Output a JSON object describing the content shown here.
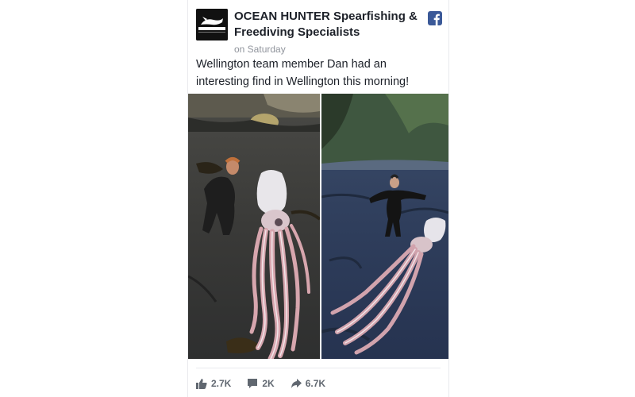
{
  "post": {
    "page_name": "OCEAN HUNTER Spearfishing & Freediving Specialists",
    "avatar_text": "OCEAN HUNTER",
    "timestamp": "on Saturday",
    "message": "Wellington team member Dan had an interesting find in Wellington this morning!",
    "platform_icon": "facebook-icon",
    "photos": [
      {
        "name": "photo-man-with-giant-squid-on-beach"
      },
      {
        "name": "photo-man-behind-giant-squid-on-beach"
      }
    ]
  },
  "reactions": {
    "likes": "2.7K",
    "comments": "2K",
    "shares": "6.7K"
  },
  "colors": {
    "facebook_blue": "#3b5998",
    "text": "#1d2129",
    "meta": "#90949c",
    "action": "#606770"
  }
}
